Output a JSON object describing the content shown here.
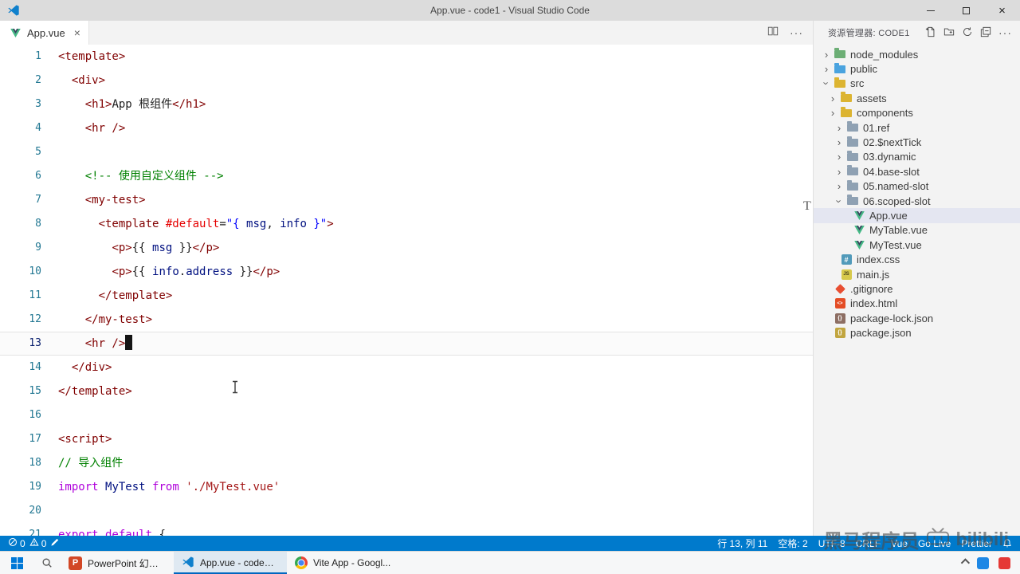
{
  "colors": {
    "statusbar": "#007acc",
    "selection": "#e4e6f1",
    "vue_green": "#41b883",
    "taskbar_accent": "#0067c0"
  },
  "window": {
    "title": "App.vue - code1 - Visual Studio Code"
  },
  "tabbar": {
    "tabs": [
      {
        "label": "App.vue"
      }
    ]
  },
  "explorer": {
    "title": "资源管理器: CODE1",
    "tree": [
      {
        "lvl": 0,
        "chev": "closed",
        "icon": "folder-node",
        "label": "node_modules"
      },
      {
        "lvl": 0,
        "chev": "closed",
        "icon": "folder-public",
        "label": "public"
      },
      {
        "lvl": 0,
        "chev": "open",
        "icon": "folder-src",
        "label": "src"
      },
      {
        "lvl": 1,
        "chev": "closed",
        "icon": "folder-assets",
        "label": "assets"
      },
      {
        "lvl": 1,
        "chev": "closed",
        "icon": "folder-components",
        "label": "components"
      },
      {
        "lvl": 2,
        "chev": "closed",
        "icon": "folder-plain",
        "label": "01.ref"
      },
      {
        "lvl": 2,
        "chev": "closed",
        "icon": "folder-plain",
        "label": "02.$nextTick"
      },
      {
        "lvl": 2,
        "chev": "closed",
        "icon": "folder-plain",
        "label": "03.dynamic"
      },
      {
        "lvl": 2,
        "chev": "closed",
        "icon": "folder-plain",
        "label": "04.base-slot"
      },
      {
        "lvl": 2,
        "chev": "closed",
        "icon": "folder-plain",
        "label": "05.named-slot"
      },
      {
        "lvl": 2,
        "chev": "open",
        "icon": "folder-plain",
        "label": "06.scoped-slot"
      },
      {
        "lvl": 3,
        "chev": "none",
        "icon": "vue",
        "label": "App.vue",
        "selected": true
      },
      {
        "lvl": 3,
        "chev": "none",
        "icon": "vue",
        "label": "MyTable.vue"
      },
      {
        "lvl": 3,
        "chev": "none",
        "icon": "vue",
        "label": "MyTest.vue"
      },
      {
        "lvl": 1,
        "chev": "none",
        "icon": "css",
        "label": "index.css"
      },
      {
        "lvl": 1,
        "chev": "none",
        "icon": "js",
        "label": "main.js"
      },
      {
        "lvl": 0,
        "chev": "none",
        "icon": "git",
        "label": ".gitignore"
      },
      {
        "lvl": 0,
        "chev": "none",
        "icon": "html",
        "label": "index.html"
      },
      {
        "lvl": 0,
        "chev": "none",
        "icon": "json-lock",
        "label": "package-lock.json"
      },
      {
        "lvl": 0,
        "chev": "none",
        "icon": "json",
        "label": "package.json"
      }
    ]
  },
  "editor": {
    "cursor_line": 13,
    "lines": [
      {
        "n": 1,
        "toks": [
          {
            "c": "t",
            "x": "<template>"
          }
        ]
      },
      {
        "n": 2,
        "toks": [
          {
            "c": "b",
            "x": "  "
          },
          {
            "c": "t",
            "x": "<div>"
          }
        ]
      },
      {
        "n": 3,
        "toks": [
          {
            "c": "b",
            "x": "    "
          },
          {
            "c": "t",
            "x": "<h1>"
          },
          {
            "c": "b",
            "x": "App 根组件"
          },
          {
            "c": "t",
            "x": "</h1>"
          }
        ]
      },
      {
        "n": 4,
        "toks": [
          {
            "c": "b",
            "x": "    "
          },
          {
            "c": "t",
            "x": "<hr />"
          }
        ]
      },
      {
        "n": 5,
        "toks": []
      },
      {
        "n": 6,
        "toks": [
          {
            "c": "b",
            "x": "    "
          },
          {
            "c": "c",
            "x": "<!-- 使用自定义组件 -->"
          }
        ]
      },
      {
        "n": 7,
        "toks": [
          {
            "c": "b",
            "x": "    "
          },
          {
            "c": "t",
            "x": "<my-test>"
          }
        ]
      },
      {
        "n": 8,
        "toks": [
          {
            "c": "b",
            "x": "      "
          },
          {
            "c": "t",
            "x": "<template "
          },
          {
            "c": "a",
            "x": "#default"
          },
          {
            "c": "b",
            "x": "="
          },
          {
            "c": "v",
            "x": "\"{ "
          },
          {
            "c": "i",
            "x": "msg"
          },
          {
            "c": "b",
            "x": ", "
          },
          {
            "c": "i",
            "x": "info"
          },
          {
            "c": "v",
            "x": " }\""
          },
          {
            "c": "t",
            "x": ">"
          }
        ]
      },
      {
        "n": 9,
        "toks": [
          {
            "c": "b",
            "x": "        "
          },
          {
            "c": "t",
            "x": "<p>"
          },
          {
            "c": "b",
            "x": "{{ "
          },
          {
            "c": "i",
            "x": "msg"
          },
          {
            "c": "b",
            "x": " }}"
          },
          {
            "c": "t",
            "x": "</p>"
          }
        ]
      },
      {
        "n": 10,
        "toks": [
          {
            "c": "b",
            "x": "        "
          },
          {
            "c": "t",
            "x": "<p>"
          },
          {
            "c": "b",
            "x": "{{ "
          },
          {
            "c": "i",
            "x": "info"
          },
          {
            "c": "b",
            "x": "."
          },
          {
            "c": "i",
            "x": "address"
          },
          {
            "c": "b",
            "x": " }}"
          },
          {
            "c": "t",
            "x": "</p>"
          }
        ]
      },
      {
        "n": 11,
        "toks": [
          {
            "c": "b",
            "x": "      "
          },
          {
            "c": "t",
            "x": "</template>"
          }
        ]
      },
      {
        "n": 12,
        "toks": [
          {
            "c": "b",
            "x": "    "
          },
          {
            "c": "t",
            "x": "</my-test>"
          }
        ]
      },
      {
        "n": 13,
        "toks": [
          {
            "c": "b",
            "x": "    "
          },
          {
            "c": "t",
            "x": "<hr />"
          }
        ]
      },
      {
        "n": 14,
        "toks": [
          {
            "c": "b",
            "x": "  "
          },
          {
            "c": "t",
            "x": "</div>"
          }
        ]
      },
      {
        "n": 15,
        "toks": [
          {
            "c": "t",
            "x": "</template>"
          }
        ]
      },
      {
        "n": 16,
        "toks": []
      },
      {
        "n": 17,
        "toks": [
          {
            "c": "t",
            "x": "<script>"
          }
        ]
      },
      {
        "n": 18,
        "toks": [
          {
            "c": "c",
            "x": "// 导入组件"
          }
        ]
      },
      {
        "n": 19,
        "toks": [
          {
            "c": "k",
            "x": "import "
          },
          {
            "c": "i",
            "x": "MyTest "
          },
          {
            "c": "k",
            "x": "from "
          },
          {
            "c": "s",
            "x": "'./MyTest.vue'"
          }
        ]
      },
      {
        "n": 20,
        "toks": []
      },
      {
        "n": 21,
        "toks": [
          {
            "c": "k",
            "x": "export default "
          },
          {
            "c": "b",
            "x": "{"
          }
        ]
      }
    ]
  },
  "statusbar": {
    "errors": "0",
    "warnings": "0",
    "line_col": "行 13, 列 11",
    "indent": "空格: 2",
    "encoding": "UTF-8",
    "eol": "CRLF",
    "language": "Vue",
    "go_live": "Go Live",
    "formatter": "Prettier"
  },
  "watermark": {
    "text": "黑马程序员",
    "brand": "bilibili"
  },
  "taskbar": {
    "apps": [
      {
        "icon": "powerpoint-icon",
        "label": "PowerPoint 幻灯..."
      },
      {
        "icon": "vscode-icon",
        "label": "App.vue - code1 - ...",
        "active": true
      },
      {
        "icon": "chrome-icon",
        "label": "Vite App - Googl..."
      }
    ]
  },
  "overlays": {
    "scroll_letter": "T"
  }
}
